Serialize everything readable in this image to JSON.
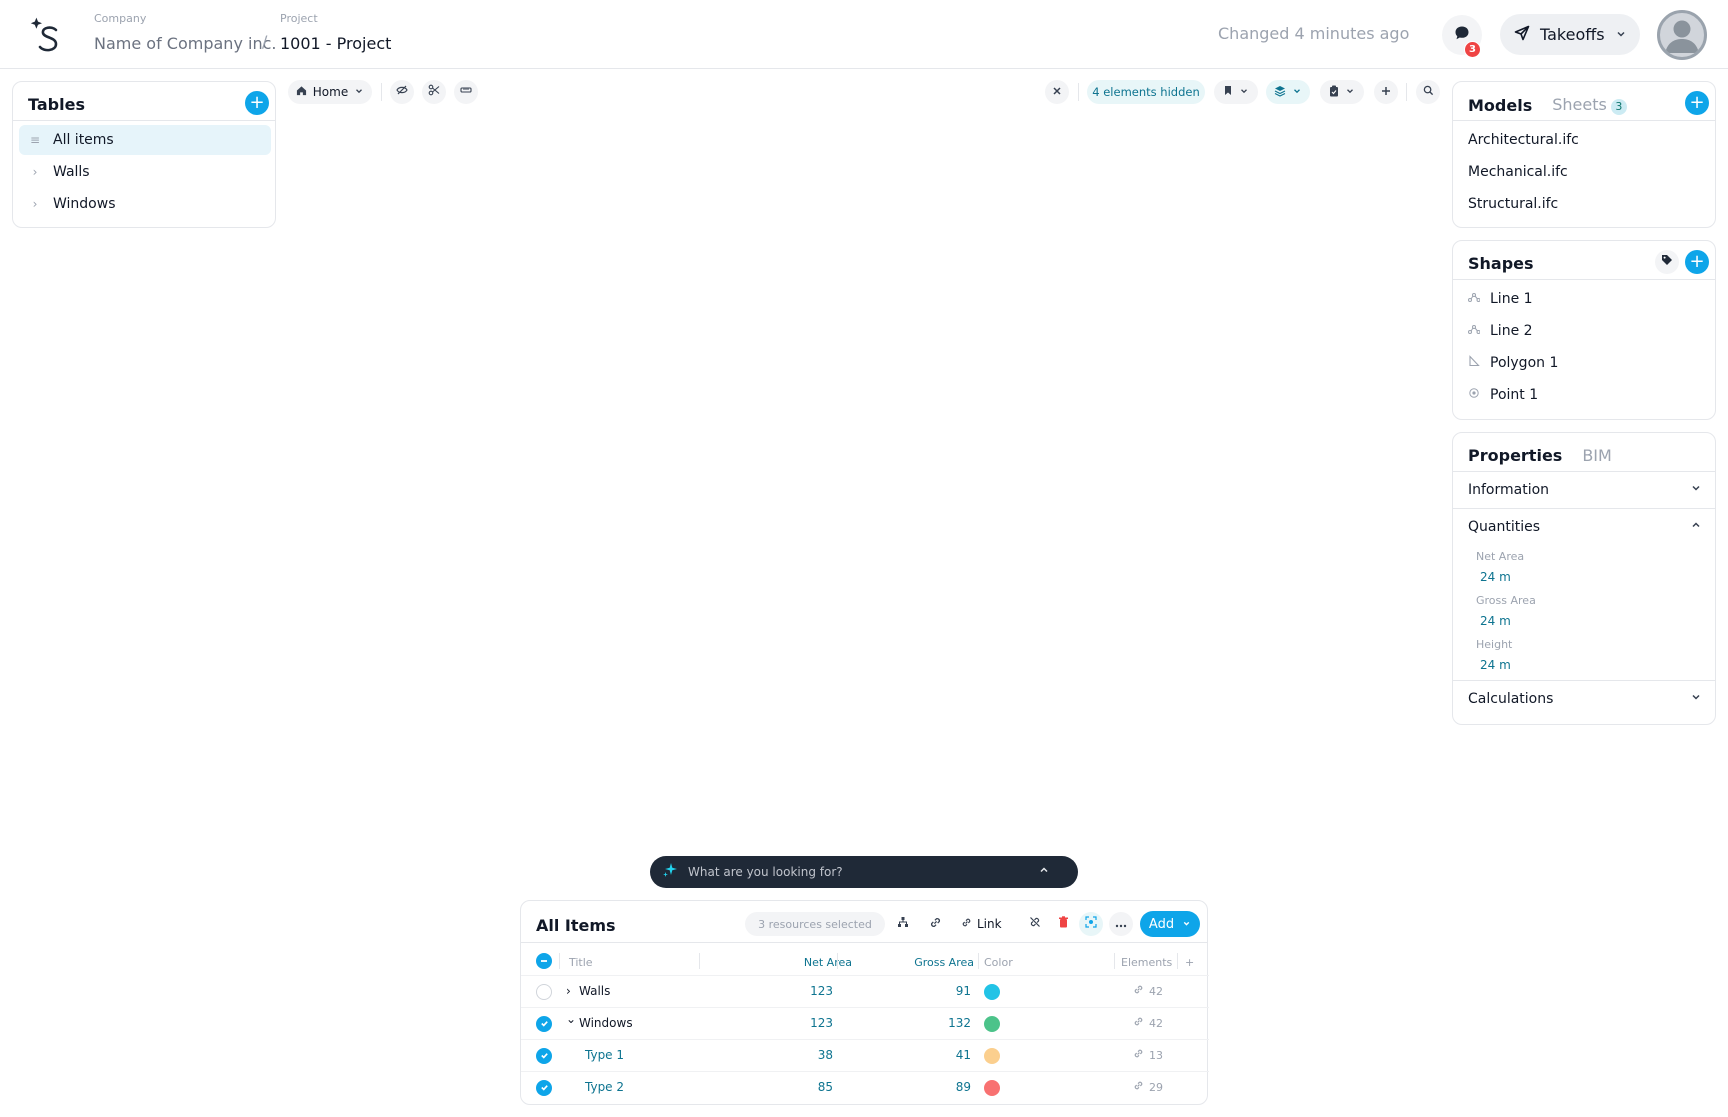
{
  "header": {
    "company_label": "Company",
    "company_name": "Name of Company inc.",
    "separator": "/",
    "project_label": "Project",
    "project_name": "1001 - Project",
    "changed_text": "Changed 4 minutes ago",
    "notifications_count": "3",
    "takeoffs_label": "Takeoffs"
  },
  "viewer_toolbar": {
    "home_label": "Home",
    "hidden_label": "4 elements hidden"
  },
  "tables": {
    "title": "Tables",
    "items": [
      {
        "label": "All items",
        "icon": "menu-icon"
      },
      {
        "label": "Walls",
        "icon": "chevron-right-icon"
      },
      {
        "label": "Windows",
        "icon": "chevron-right-icon"
      }
    ]
  },
  "models": {
    "tab_models": "Models",
    "tab_sheets": "Sheets",
    "sheets_count": "3",
    "items": [
      "Architectural.ifc",
      "Mechanical.ifc",
      "Structural.ifc"
    ]
  },
  "shapes": {
    "title": "Shapes",
    "items": [
      {
        "label": "Line 1",
        "icon": "line-icon"
      },
      {
        "label": "Line 2",
        "icon": "line-icon"
      },
      {
        "label": "Polygon 1",
        "icon": "polygon-icon"
      },
      {
        "label": "Point 1",
        "icon": "point-icon"
      }
    ]
  },
  "properties": {
    "tab_properties": "Properties",
    "tab_bim": "BIM",
    "sections": {
      "information": "Information",
      "quantities": "Quantities",
      "calculations": "Calculations"
    },
    "quantities": [
      {
        "label": "Net Area",
        "value": "24 m"
      },
      {
        "label": "Gross Area",
        "value": "24 m"
      },
      {
        "label": "Height",
        "value": "24 m"
      }
    ]
  },
  "search": {
    "placeholder": "What are you looking for?"
  },
  "items_table": {
    "title": "All Items",
    "selected_text": "3 resources selected",
    "link_label": "Link",
    "add_label": "Add",
    "columns": {
      "title": "Title",
      "net_area": "Net Area",
      "gross_area": "Gross Area",
      "color": "Color",
      "elements": "Elements",
      "add": "+"
    },
    "rows": [
      {
        "title": "Walls",
        "net_area": "123",
        "gross_area": "91",
        "color": "#22c3e6",
        "elements": "42",
        "checked": false,
        "expander": "›"
      },
      {
        "title": "Windows",
        "net_area": "123",
        "gross_area": "132",
        "color": "#4cc38a",
        "elements": "42",
        "checked": true,
        "expander": "⌄"
      },
      {
        "title": "Type 1",
        "net_area": "38",
        "gross_area": "41",
        "color": "#fbcf8e",
        "elements": "13",
        "checked": true,
        "expander": ""
      },
      {
        "title": "Type 2",
        "net_area": "85",
        "gross_area": "89",
        "color": "#f87171",
        "elements": "29",
        "checked": true,
        "expander": ""
      }
    ]
  }
}
